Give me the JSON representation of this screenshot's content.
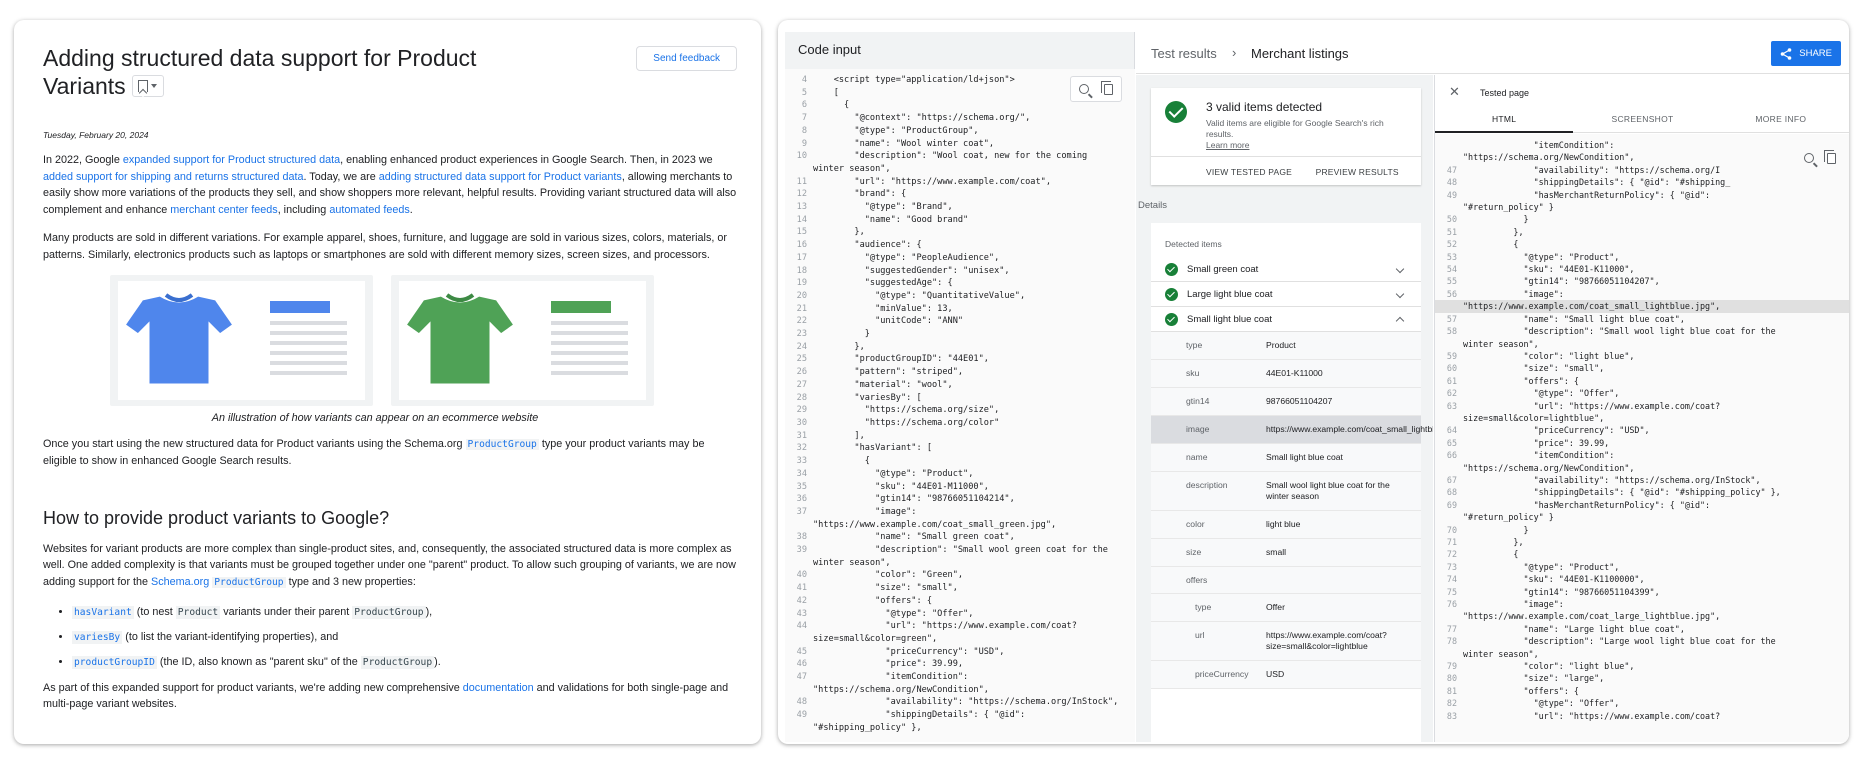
{
  "blog": {
    "title": "Adding structured data support for Product Variants",
    "feedback_label": "Send feedback",
    "date": "Tuesday, February 20, 2024",
    "p1": {
      "t1": "In 2022, Google ",
      "l1": "expanded support for Product structured data",
      "t2": ", enabling enhanced product experiences in Google Search. Then, in 2023 we ",
      "l2": "added support for shipping and returns structured data",
      "t3": ". Today, we are ",
      "l3": "adding structured data support for Product variants",
      "t4": ", allowing merchants to easily show more variations of the products they sell, and show shoppers more relevant, helpful results. Providing variant structured data will also complement and enhance ",
      "l4": "merchant center feeds",
      "t5": ", including ",
      "l5": "automated feeds",
      "t6": "."
    },
    "p2": "Many products are sold in different variations. For example apparel, shoes, furniture, and luggage are sold in various sizes, colors, materials, or patterns. Similarly, electronics products such as laptops or smartphones are sold with different memory sizes, screen sizes, and processors.",
    "figure": {
      "caption": "An illustration of how variants can appear on an ecommerce website",
      "colors": [
        "#4f86ec",
        "#4fa256"
      ]
    },
    "p3": {
      "t1": "Once you start using the new structured data for Product variants using the Schema.org ",
      "code": "ProductGroup",
      "t2": " type your product variants may be eligible to show in enhanced Google Search results."
    },
    "h2": "How to provide product variants to Google?",
    "p4": {
      "t1": "Websites for variant products are more complex than single-product sites, and, consequently, the associated structured data is more complex as well. One added complexity is that variants must be grouped together under one \"parent\" product. To allow such grouping of variants, we are now adding support for the ",
      "link": "Schema.org ",
      "code": "ProductGroup",
      "t2": " type and 3 new properties:"
    },
    "bullets": [
      {
        "code": "hasVariant",
        "t1": " (to nest ",
        "code2": "Product",
        "t2": " variants under their parent ",
        "code3": "ProductGroup",
        "t3": "),"
      },
      {
        "code": "variesBy",
        "t1": " (to list the variant-identifying properties), and",
        "code2": "",
        "t2": "",
        "code3": "",
        "t3": ""
      },
      {
        "code": "productGroupID",
        "t1": " (the ID, also known as \"parent sku\" of the ",
        "code2": "ProductGroup",
        "t2": ").",
        "code3": "",
        "t3": ""
      }
    ],
    "p5": {
      "t1": "As part of this expanded support for product variants, we're adding new comprehensive ",
      "link": "documentation",
      "t2": " and validations for both single-page and multi-page variant websites."
    }
  },
  "tool": {
    "code_title": "Code input",
    "code_lines": [
      [
        "4",
        "    <script type=\"application/ld+json\">"
      ],
      [
        "5",
        "    ["
      ],
      [
        "6",
        "      {"
      ],
      [
        "7",
        "        \"@context\": \"https://schema.org/\","
      ],
      [
        "8",
        "        \"@type\": \"ProductGroup\","
      ],
      [
        "9",
        "        \"name\": \"Wool winter coat\","
      ],
      [
        "10",
        "        \"description\": \"Wool coat, new for the coming"
      ],
      [
        "",
        "winter season\","
      ],
      [
        "11",
        "        \"url\": \"https://www.example.com/coat\","
      ],
      [
        "12",
        "        \"brand\": {"
      ],
      [
        "13",
        "          \"@type\": \"Brand\","
      ],
      [
        "14",
        "          \"name\": \"Good brand\""
      ],
      [
        "15",
        "        },"
      ],
      [
        "16",
        "        \"audience\": {"
      ],
      [
        "17",
        "          \"@type\": \"PeopleAudience\","
      ],
      [
        "18",
        "          \"suggestedGender\": \"unisex\","
      ],
      [
        "19",
        "          \"suggestedAge\": {"
      ],
      [
        "20",
        "            \"@type\": \"QuantitativeValue\","
      ],
      [
        "21",
        "            \"minValue\": 13,"
      ],
      [
        "22",
        "            \"unitCode\": \"ANN\""
      ],
      [
        "23",
        "          }"
      ],
      [
        "24",
        "        },"
      ],
      [
        "25",
        "        \"productGroupID\": \"44E01\","
      ],
      [
        "26",
        "        \"pattern\": \"striped\","
      ],
      [
        "27",
        "        \"material\": \"wool\","
      ],
      [
        "28",
        "        \"variesBy\": ["
      ],
      [
        "29",
        "          \"https://schema.org/size\","
      ],
      [
        "30",
        "          \"https://schema.org/color\""
      ],
      [
        "31",
        "        ],"
      ],
      [
        "32",
        "        \"hasVariant\": ["
      ],
      [
        "33",
        "          {"
      ],
      [
        "34",
        "            \"@type\": \"Product\","
      ],
      [
        "35",
        "            \"sku\": \"44E01-M11000\","
      ],
      [
        "36",
        "            \"gtin14\": \"98766051104214\","
      ],
      [
        "37",
        "            \"image\":"
      ],
      [
        "",
        "\"https://www.example.com/coat_small_green.jpg\","
      ],
      [
        "38",
        "            \"name\": \"Small green coat\","
      ],
      [
        "39",
        "            \"description\": \"Small wool green coat for the"
      ],
      [
        "",
        "winter season\","
      ],
      [
        "40",
        "            \"color\": \"Green\","
      ],
      [
        "41",
        "            \"size\": \"small\","
      ],
      [
        "42",
        "            \"offers\": {"
      ],
      [
        "43",
        "              \"@type\": \"Offer\","
      ],
      [
        "44",
        "              \"url\": \"https://www.example.com/coat?"
      ],
      [
        "",
        "size=small&color=green\","
      ],
      [
        "45",
        "              \"priceCurrency\": \"USD\","
      ],
      [
        "46",
        "              \"price\": 39.99,"
      ],
      [
        "47",
        "              \"itemCondition\":"
      ],
      [
        "",
        "\"https://schema.org/NewCondition\","
      ],
      [
        "48",
        "              \"availability\": \"https://schema.org/InStock\","
      ],
      [
        "49",
        "              \"shippingDetails\": { \"@id\":"
      ],
      [
        "",
        "\"#shipping_policy\" },"
      ]
    ],
    "crumb1": "Test results",
    "crumb2": "Merchant listings",
    "share_label": "SHARE",
    "valid": {
      "title": "3 valid items detected",
      "sub": "Valid items are eligible for Google Search's rich results.",
      "learn": "Learn more",
      "view": "VIEW TESTED PAGE",
      "preview": "PREVIEW RESULTS"
    },
    "details_label": "Details",
    "detected_label": "Detected items",
    "items": [
      "Small green coat",
      "Large light blue coat",
      "Small light blue coat"
    ],
    "props": [
      {
        "k": "type",
        "v": "Product"
      },
      {
        "k": "sku",
        "v": "44E01-K11000"
      },
      {
        "k": "gtin14",
        "v": "98766051104207"
      },
      {
        "k": "image",
        "v": "https://www.example.com/coat_small_lightblue.jpg"
      },
      {
        "k": "name",
        "v": "Small light blue coat"
      },
      {
        "k": "description",
        "v": "Small wool light blue coat for the winter season"
      },
      {
        "k": "color",
        "v": "light blue"
      },
      {
        "k": "size",
        "v": "small"
      },
      {
        "k": "offers",
        "v": ""
      },
      {
        "k": "type",
        "v": "Offer"
      },
      {
        "k": "url",
        "v": "https://www.example.com/coat?size=small&color=lightblue"
      },
      {
        "k": "priceCurrency",
        "v": "USD"
      }
    ],
    "src_title": "Tested page",
    "tabs": [
      "HTML",
      "SCREENSHOT",
      "MORE INFO"
    ],
    "src_lines": [
      [
        "",
        "              \"itemCondition\":"
      ],
      [
        "",
        "\"https://schema.org/NewCondition\","
      ],
      [
        "47",
        "              \"availability\": \"https://schema.org/I"
      ],
      [
        "48",
        "              \"shippingDetails\": { \"@id\": \"#shipping_"
      ],
      [
        "49",
        "              \"hasMerchantReturnPolicy\": { \"@id\":"
      ],
      [
        "",
        "\"#return_policy\" }"
      ],
      [
        "50",
        "            }"
      ],
      [
        "51",
        "          },"
      ],
      [
        "52",
        "          {"
      ],
      [
        "53",
        "            \"@type\": \"Product\","
      ],
      [
        "54",
        "            \"sku\": \"44E01-K11000\","
      ],
      [
        "55",
        "            \"gtin14\": \"98766051104207\","
      ],
      [
        "56",
        "            \"image\":"
      ],
      [
        "",
        "\"https://www.example.com/coat_small_lightblue.jpg\","
      ],
      [
        "57",
        "            \"name\": \"Small light blue coat\","
      ],
      [
        "58",
        "            \"description\": \"Small wool light blue coat for the"
      ],
      [
        "",
        "winter season\","
      ],
      [
        "59",
        "            \"color\": \"light blue\","
      ],
      [
        "60",
        "            \"size\": \"small\","
      ],
      [
        "61",
        "            \"offers\": {"
      ],
      [
        "62",
        "              \"@type\": \"Offer\","
      ],
      [
        "63",
        "              \"url\": \"https://www.example.com/coat?"
      ],
      [
        "",
        "size=small&color=lightblue\","
      ],
      [
        "64",
        "              \"priceCurrency\": \"USD\","
      ],
      [
        "65",
        "              \"price\": 39.99,"
      ],
      [
        "66",
        "              \"itemCondition\":"
      ],
      [
        "",
        "\"https://schema.org/NewCondition\","
      ],
      [
        "67",
        "              \"availability\": \"https://schema.org/InStock\","
      ],
      [
        "68",
        "              \"shippingDetails\": { \"@id\": \"#shipping_policy\" },"
      ],
      [
        "69",
        "              \"hasMerchantReturnPolicy\": { \"@id\":"
      ],
      [
        "",
        "\"#return_policy\" }"
      ],
      [
        "70",
        "            }"
      ],
      [
        "71",
        "          },"
      ],
      [
        "72",
        "          {"
      ],
      [
        "73",
        "            \"@type\": \"Product\","
      ],
      [
        "74",
        "            \"sku\": \"44E01-K1100000\","
      ],
      [
        "75",
        "            \"gtin14\": \"98766051104399\","
      ],
      [
        "76",
        "            \"image\":"
      ],
      [
        "",
        "\"https://www.example.com/coat_large_lightblue.jpg\","
      ],
      [
        "77",
        "            \"name\": \"Large light blue coat\","
      ],
      [
        "78",
        "            \"description\": \"Large wool light blue coat for the"
      ],
      [
        "",
        "winter season\","
      ],
      [
        "79",
        "            \"color\": \"light blue\","
      ],
      [
        "80",
        "            \"size\": \"large\","
      ],
      [
        "81",
        "            \"offers\": {"
      ],
      [
        "82",
        "              \"@type\": \"Offer\","
      ],
      [
        "83",
        "              \"url\": \"https://www.example.com/coat?"
      ]
    ],
    "highlight_line": 13
  }
}
